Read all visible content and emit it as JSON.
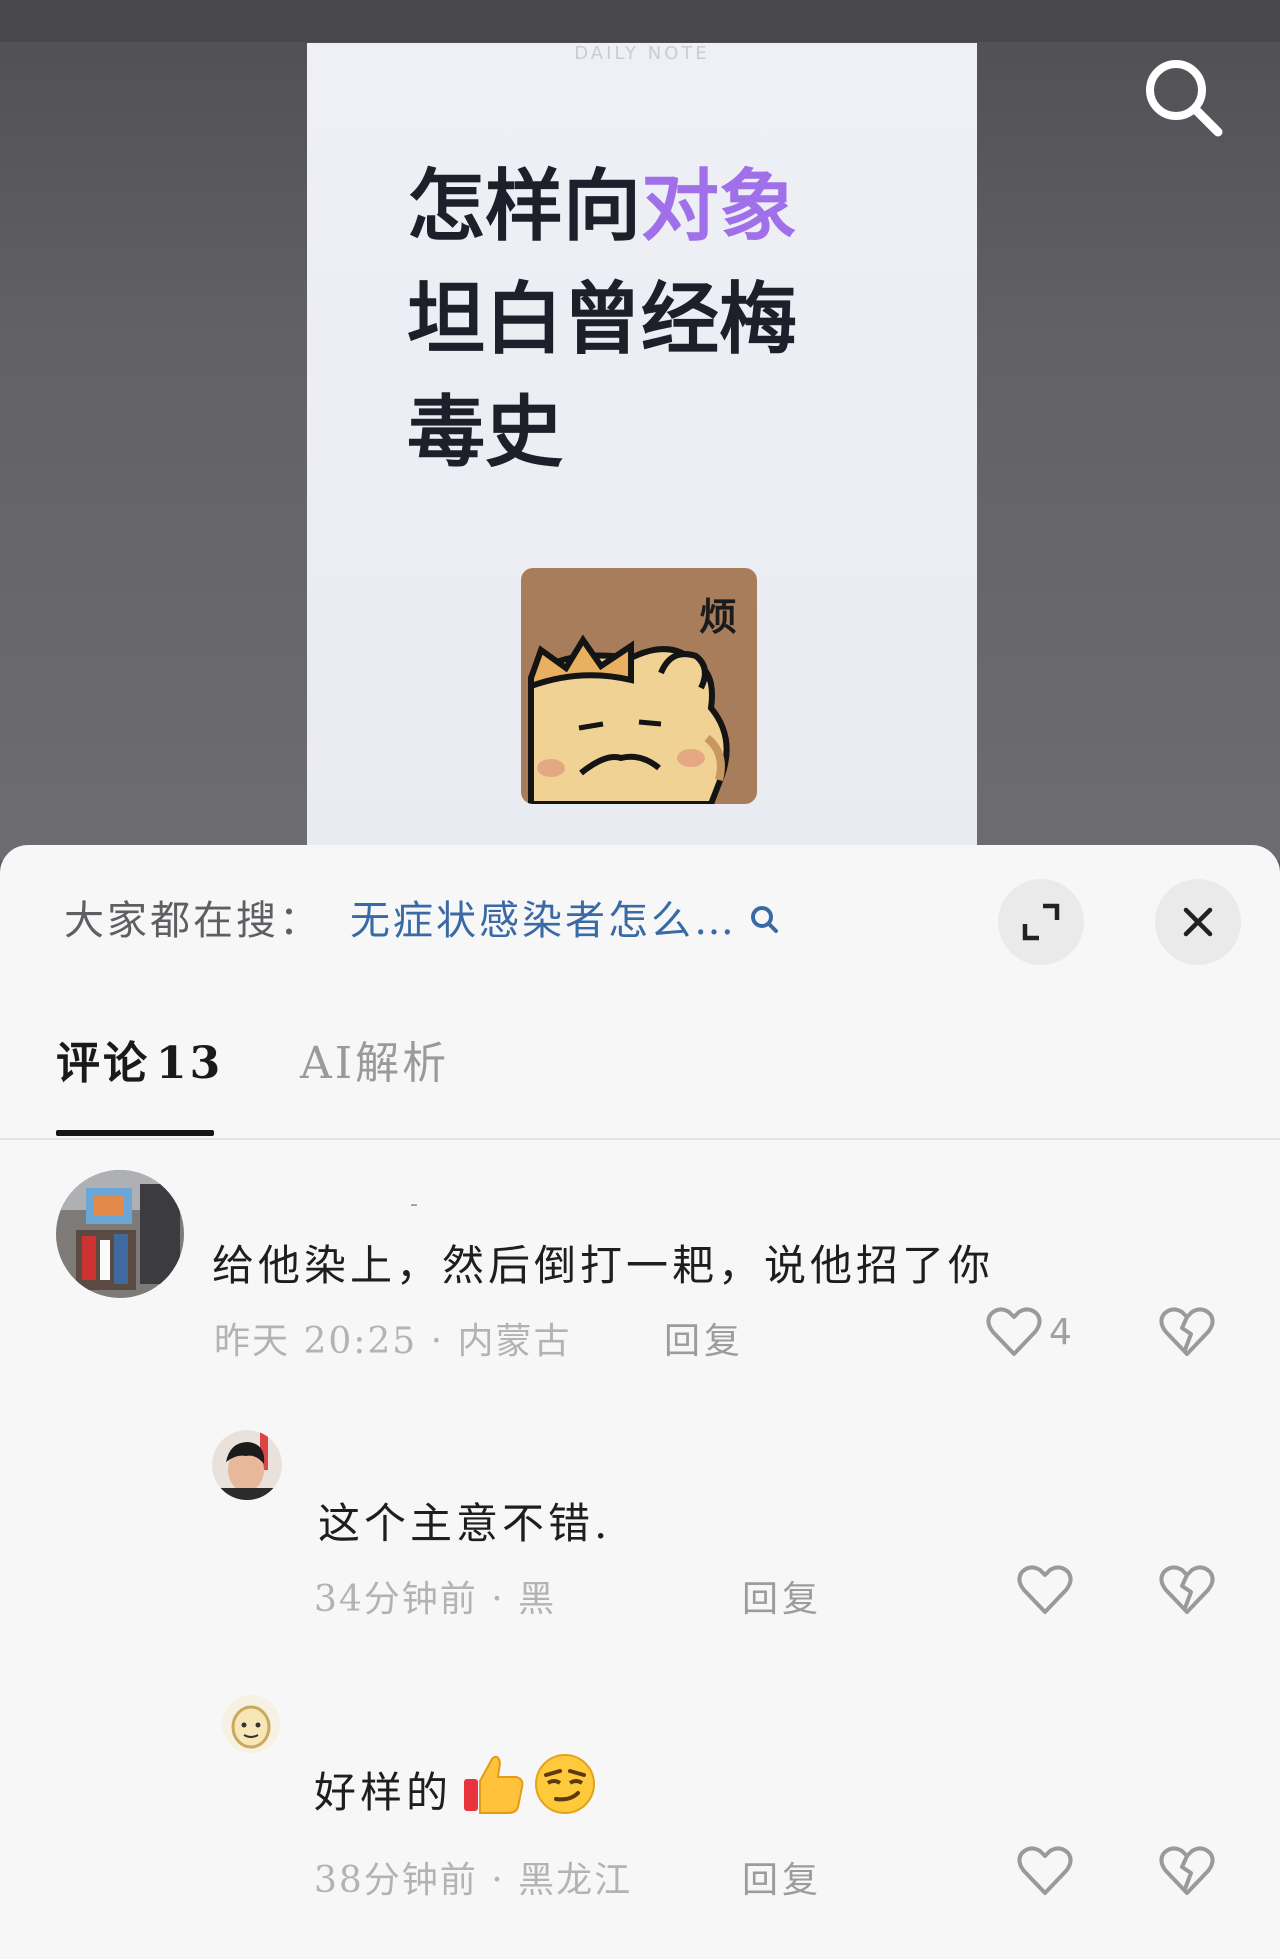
{
  "post": {
    "watermark": "DAILY NOTE",
    "title_line1_prefix": "怎样向",
    "title_line1_highlight": "对象",
    "title_line2": "坦白曾经梅",
    "title_line3": "毒史",
    "sticker_text": "烦"
  },
  "colors": {
    "title_highlight": "#a070ea",
    "search_query": "#3a6aa6",
    "tab_active": "#161616"
  },
  "sheet": {
    "search_prefix": "大家都在搜：",
    "search_query": "无症状感染者怎么…",
    "expand_icon": "expand-icon",
    "close_icon": "close-icon"
  },
  "tabs": [
    {
      "label": "评论",
      "count": "13"
    },
    {
      "label": "AI解析"
    }
  ],
  "comments": [
    {
      "username": "-",
      "text": "给他染上，然后倒打一耙，说他招了你",
      "time": "昨天 20:25",
      "location": "内蒙古",
      "reply_label": "回复",
      "likes": "4"
    },
    {
      "text": "这个主意不错.",
      "time": "34分钟前",
      "location": "黑",
      "reply_label": "回复"
    },
    {
      "text": "好样的",
      "emojis": [
        "thumbs-up",
        "smirk-face"
      ],
      "time": "38分钟前",
      "location": "黑龙江",
      "reply_label": "回复"
    }
  ]
}
